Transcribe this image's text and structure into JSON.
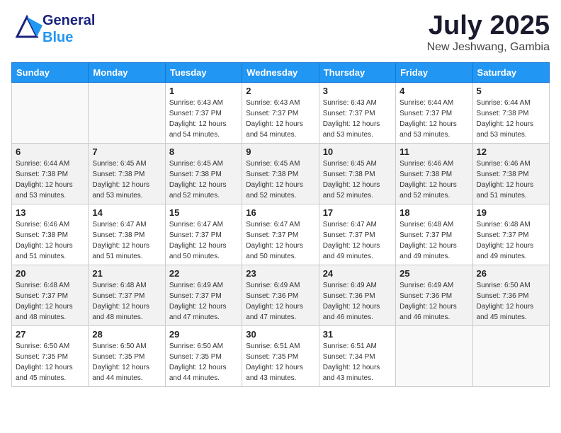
{
  "header": {
    "logo_general": "General",
    "logo_blue": "Blue",
    "month_title": "July 2025",
    "location": "New Jeshwang, Gambia"
  },
  "weekdays": [
    "Sunday",
    "Monday",
    "Tuesday",
    "Wednesday",
    "Thursday",
    "Friday",
    "Saturday"
  ],
  "weeks": [
    [
      {
        "day": "",
        "sunrise": "",
        "sunset": "",
        "daylight": ""
      },
      {
        "day": "",
        "sunrise": "",
        "sunset": "",
        "daylight": ""
      },
      {
        "day": "1",
        "sunrise": "Sunrise: 6:43 AM",
        "sunset": "Sunset: 7:37 PM",
        "daylight": "Daylight: 12 hours and 54 minutes."
      },
      {
        "day": "2",
        "sunrise": "Sunrise: 6:43 AM",
        "sunset": "Sunset: 7:37 PM",
        "daylight": "Daylight: 12 hours and 54 minutes."
      },
      {
        "day": "3",
        "sunrise": "Sunrise: 6:43 AM",
        "sunset": "Sunset: 7:37 PM",
        "daylight": "Daylight: 12 hours and 53 minutes."
      },
      {
        "day": "4",
        "sunrise": "Sunrise: 6:44 AM",
        "sunset": "Sunset: 7:37 PM",
        "daylight": "Daylight: 12 hours and 53 minutes."
      },
      {
        "day": "5",
        "sunrise": "Sunrise: 6:44 AM",
        "sunset": "Sunset: 7:38 PM",
        "daylight": "Daylight: 12 hours and 53 minutes."
      }
    ],
    [
      {
        "day": "6",
        "sunrise": "Sunrise: 6:44 AM",
        "sunset": "Sunset: 7:38 PM",
        "daylight": "Daylight: 12 hours and 53 minutes."
      },
      {
        "day": "7",
        "sunrise": "Sunrise: 6:45 AM",
        "sunset": "Sunset: 7:38 PM",
        "daylight": "Daylight: 12 hours and 53 minutes."
      },
      {
        "day": "8",
        "sunrise": "Sunrise: 6:45 AM",
        "sunset": "Sunset: 7:38 PM",
        "daylight": "Daylight: 12 hours and 52 minutes."
      },
      {
        "day": "9",
        "sunrise": "Sunrise: 6:45 AM",
        "sunset": "Sunset: 7:38 PM",
        "daylight": "Daylight: 12 hours and 52 minutes."
      },
      {
        "day": "10",
        "sunrise": "Sunrise: 6:45 AM",
        "sunset": "Sunset: 7:38 PM",
        "daylight": "Daylight: 12 hours and 52 minutes."
      },
      {
        "day": "11",
        "sunrise": "Sunrise: 6:46 AM",
        "sunset": "Sunset: 7:38 PM",
        "daylight": "Daylight: 12 hours and 52 minutes."
      },
      {
        "day": "12",
        "sunrise": "Sunrise: 6:46 AM",
        "sunset": "Sunset: 7:38 PM",
        "daylight": "Daylight: 12 hours and 51 minutes."
      }
    ],
    [
      {
        "day": "13",
        "sunrise": "Sunrise: 6:46 AM",
        "sunset": "Sunset: 7:38 PM",
        "daylight": "Daylight: 12 hours and 51 minutes."
      },
      {
        "day": "14",
        "sunrise": "Sunrise: 6:47 AM",
        "sunset": "Sunset: 7:38 PM",
        "daylight": "Daylight: 12 hours and 51 minutes."
      },
      {
        "day": "15",
        "sunrise": "Sunrise: 6:47 AM",
        "sunset": "Sunset: 7:37 PM",
        "daylight": "Daylight: 12 hours and 50 minutes."
      },
      {
        "day": "16",
        "sunrise": "Sunrise: 6:47 AM",
        "sunset": "Sunset: 7:37 PM",
        "daylight": "Daylight: 12 hours and 50 minutes."
      },
      {
        "day": "17",
        "sunrise": "Sunrise: 6:47 AM",
        "sunset": "Sunset: 7:37 PM",
        "daylight": "Daylight: 12 hours and 49 minutes."
      },
      {
        "day": "18",
        "sunrise": "Sunrise: 6:48 AM",
        "sunset": "Sunset: 7:37 PM",
        "daylight": "Daylight: 12 hours and 49 minutes."
      },
      {
        "day": "19",
        "sunrise": "Sunrise: 6:48 AM",
        "sunset": "Sunset: 7:37 PM",
        "daylight": "Daylight: 12 hours and 49 minutes."
      }
    ],
    [
      {
        "day": "20",
        "sunrise": "Sunrise: 6:48 AM",
        "sunset": "Sunset: 7:37 PM",
        "daylight": "Daylight: 12 hours and 48 minutes."
      },
      {
        "day": "21",
        "sunrise": "Sunrise: 6:48 AM",
        "sunset": "Sunset: 7:37 PM",
        "daylight": "Daylight: 12 hours and 48 minutes."
      },
      {
        "day": "22",
        "sunrise": "Sunrise: 6:49 AM",
        "sunset": "Sunset: 7:37 PM",
        "daylight": "Daylight: 12 hours and 47 minutes."
      },
      {
        "day": "23",
        "sunrise": "Sunrise: 6:49 AM",
        "sunset": "Sunset: 7:36 PM",
        "daylight": "Daylight: 12 hours and 47 minutes."
      },
      {
        "day": "24",
        "sunrise": "Sunrise: 6:49 AM",
        "sunset": "Sunset: 7:36 PM",
        "daylight": "Daylight: 12 hours and 46 minutes."
      },
      {
        "day": "25",
        "sunrise": "Sunrise: 6:49 AM",
        "sunset": "Sunset: 7:36 PM",
        "daylight": "Daylight: 12 hours and 46 minutes."
      },
      {
        "day": "26",
        "sunrise": "Sunrise: 6:50 AM",
        "sunset": "Sunset: 7:36 PM",
        "daylight": "Daylight: 12 hours and 45 minutes."
      }
    ],
    [
      {
        "day": "27",
        "sunrise": "Sunrise: 6:50 AM",
        "sunset": "Sunset: 7:35 PM",
        "daylight": "Daylight: 12 hours and 45 minutes."
      },
      {
        "day": "28",
        "sunrise": "Sunrise: 6:50 AM",
        "sunset": "Sunset: 7:35 PM",
        "daylight": "Daylight: 12 hours and 44 minutes."
      },
      {
        "day": "29",
        "sunrise": "Sunrise: 6:50 AM",
        "sunset": "Sunset: 7:35 PM",
        "daylight": "Daylight: 12 hours and 44 minutes."
      },
      {
        "day": "30",
        "sunrise": "Sunrise: 6:51 AM",
        "sunset": "Sunset: 7:35 PM",
        "daylight": "Daylight: 12 hours and 43 minutes."
      },
      {
        "day": "31",
        "sunrise": "Sunrise: 6:51 AM",
        "sunset": "Sunset: 7:34 PM",
        "daylight": "Daylight: 12 hours and 43 minutes."
      },
      {
        "day": "",
        "sunrise": "",
        "sunset": "",
        "daylight": ""
      },
      {
        "day": "",
        "sunrise": "",
        "sunset": "",
        "daylight": ""
      }
    ]
  ]
}
